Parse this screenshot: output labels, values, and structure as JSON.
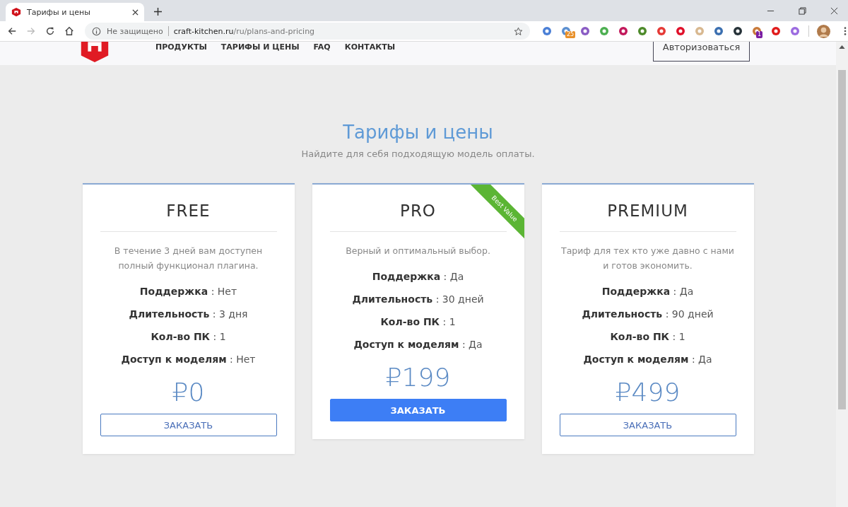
{
  "browser": {
    "tab_title": "Тарифы и цены",
    "security": "Не защищено",
    "url_host": "craft-kitchen.ru",
    "url_path": "/ru/plans-and-pricing",
    "extensions": [
      {
        "kind": "plain"
      },
      {
        "kind": "badged",
        "badge": "25",
        "color": "#e8902a"
      },
      {
        "kind": "plain"
      },
      {
        "kind": "plain"
      },
      {
        "kind": "plain"
      },
      {
        "kind": "plain"
      },
      {
        "kind": "plain"
      },
      {
        "kind": "plain"
      },
      {
        "kind": "plain"
      },
      {
        "kind": "plain"
      },
      {
        "kind": "plain"
      },
      {
        "kind": "badged",
        "badge": "1",
        "color": "#7b1fa2"
      },
      {
        "kind": "plain"
      },
      {
        "kind": "plain"
      }
    ]
  },
  "header": {
    "nav": [
      "ПРОДУКТЫ",
      "ТАРИФЫ И ЦЕНЫ",
      "FAQ",
      "КОНТАКТЫ"
    ],
    "login": "Авторизоваться"
  },
  "page": {
    "title": "Тарифы и цены",
    "subtitle": "Найдите для себя подходящую модель оплаты."
  },
  "plans": [
    {
      "name": "FREE",
      "description": "В течение 3 дней вам доступен полный функционал плагина.",
      "featured": false,
      "features": [
        "**Поддержка** : Нет",
        "**Длительность** : 3 дня",
        "**Кол-во ПК** : 1",
        "**Доступ к моделям** : Нет"
      ],
      "price": "₽0",
      "button": "ЗАКАЗАТЬ"
    },
    {
      "name": "PRO",
      "ribbon": "Best Value",
      "description": "Верный и оптимальный выбор.",
      "featured": true,
      "features": [
        "**Поддержка** : Да",
        "**Длительность** : 30 дней",
        "**Кол-во ПК** : 1",
        "**Доступ к моделям** : Да"
      ],
      "price": "₽199",
      "button": "ЗАКАЗАТЬ"
    },
    {
      "name": "PREMIUM",
      "description": "Тариф для тех кто уже давно с нами и готов экономить.",
      "featured": false,
      "features": [
        "**Поддержка** : Да",
        "**Длительность** : 90 дней",
        "**Кол-во ПК** : 1",
        "**Доступ к моделям** : Да"
      ],
      "price": "₽499",
      "button": "ЗАКАЗАТЬ"
    }
  ]
}
